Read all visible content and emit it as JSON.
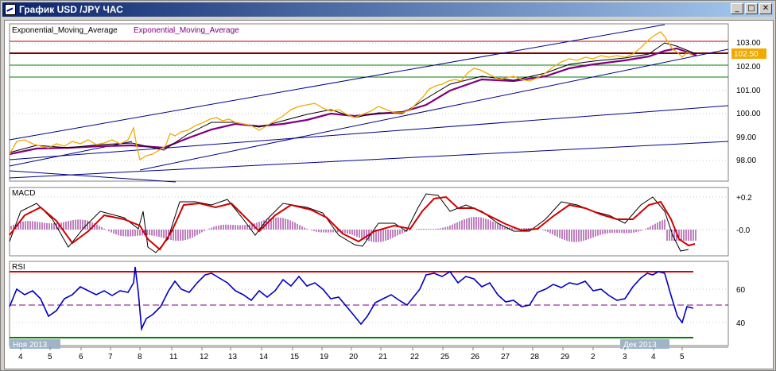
{
  "window": {
    "title": "График USD /JPY  ЧАС",
    "min_glyph": "_",
    "max_glyph": "□",
    "close_glyph": "✕"
  },
  "legend": {
    "ema1": "Exponential_Moving_Average",
    "ema2": "Exponential_Moving_Average"
  },
  "panels": {
    "macd_label": "MACD",
    "rsi_label": "RSI"
  },
  "colors": {
    "price": "#f2a900",
    "ema_fast": "#000000",
    "ema_slow": "#800080",
    "channel": "#00008b",
    "resistance": "#c00000",
    "support": "#008000",
    "macd_signal": "#d00000",
    "rsi_line": "#0000c0"
  },
  "price_badge": "102.50",
  "chart_data": [
    {
      "type": "line",
      "name": "price",
      "y_ticks": [
        "103.00",
        "102.00",
        "101.00",
        "100.00",
        "99.00",
        "98.00"
      ],
      "ylim": [
        97.5,
        103.6
      ],
      "current": 102.5,
      "hlines": [
        103.0,
        102.5,
        102.2,
        101.6
      ]
    },
    {
      "type": "line",
      "name": "macd",
      "y_ticks": [
        "+0.2",
        "-0.0"
      ]
    },
    {
      "type": "line",
      "name": "rsi",
      "y_ticks": [
        "60",
        "40"
      ],
      "levels": [
        70,
        50,
        30
      ]
    }
  ],
  "x_axis": {
    "ticks": [
      "4",
      "5",
      "6",
      "7",
      "8",
      "11",
      "12",
      "13",
      "14",
      "15",
      "19",
      "20",
      "21",
      "22",
      "25",
      "26",
      "27",
      "28",
      "29",
      "2",
      "3",
      "4",
      "5"
    ],
    "month_left": "Ноя 2013",
    "month_right": "Дек 2013"
  }
}
